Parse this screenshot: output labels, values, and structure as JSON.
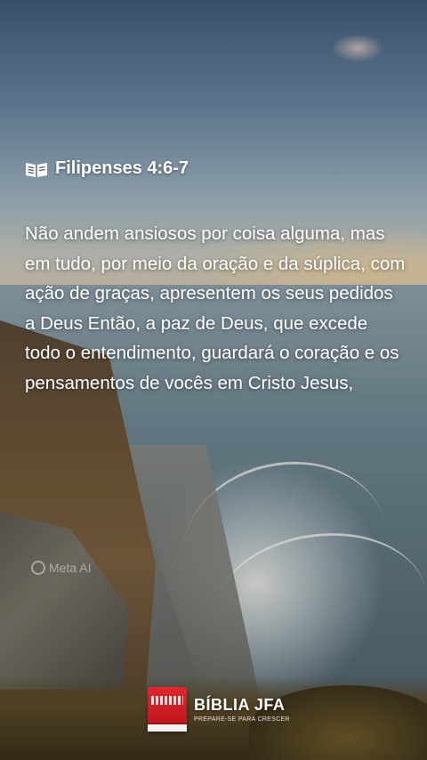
{
  "verse": {
    "reference": "Filipenses 4:6-7",
    "icon": "book-icon",
    "text": "Não andem ansiosos por coisa alguma, mas em tudo, por meio da oração e da súplica, com ação de graças, apresentem os seus pedidos a Deus Então, a paz de Deus, que excede todo o entendimento, guardará o coração e os pensamentos de vocês em Cristo Jesus,"
  },
  "watermark": {
    "icon": "meta-ai-icon",
    "label": "Meta AI"
  },
  "brand": {
    "name": "BÍBLIA JFA",
    "tagline": "PREPARE-SE PARA CRESCER",
    "logo_color": "#d81e24"
  }
}
